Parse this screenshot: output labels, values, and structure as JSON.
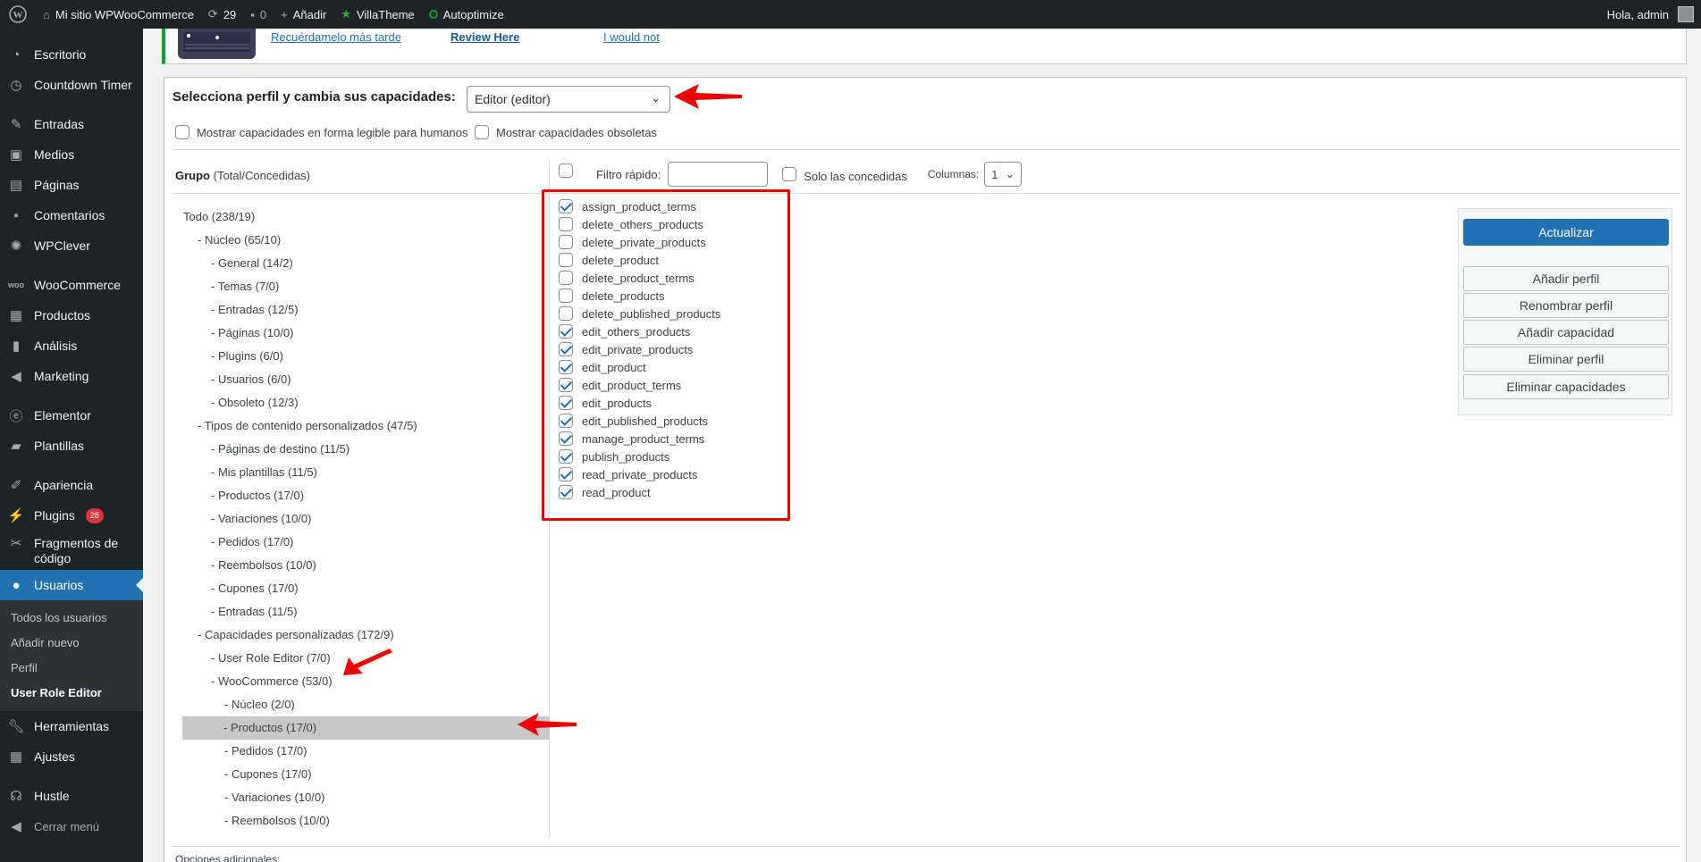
{
  "adminbar": {
    "site_name": "Mi sitio WPWooCommerce",
    "updates": "29",
    "comments": "0",
    "add_new": "Añadir",
    "villatheme": "VillaTheme",
    "autoptimize": "Autoptimize",
    "greeting": "Hola, admin"
  },
  "sidebar": {
    "items": [
      {
        "label": "Escritorio",
        "icon": "dashboard-icon"
      },
      {
        "label": "Countdown Timer",
        "icon": "clock-icon"
      },
      {
        "label": "Entradas",
        "icon": "pin-icon"
      },
      {
        "label": "Medios",
        "icon": "media-icon"
      },
      {
        "label": "Páginas",
        "icon": "page-icon"
      },
      {
        "label": "Comentarios",
        "icon": "comment-icon"
      },
      {
        "label": "WPClever",
        "icon": "bulb-icon"
      },
      {
        "label": "WooCommerce",
        "icon": "woo-icon"
      },
      {
        "label": "Productos",
        "icon": "archive-icon"
      },
      {
        "label": "Análisis",
        "icon": "chart-icon"
      },
      {
        "label": "Marketing",
        "icon": "megaphone-icon"
      },
      {
        "label": "Elementor",
        "icon": "elementor-icon"
      },
      {
        "label": "Plantillas",
        "icon": "folder-icon"
      },
      {
        "label": "Apariencia",
        "icon": "brush-icon"
      },
      {
        "label": "Plugins",
        "icon": "plugin-icon",
        "badge": "28"
      },
      {
        "label": "Fragmentos de código",
        "icon": "scissors-icon"
      },
      {
        "label": "Usuarios",
        "icon": "user-icon"
      },
      {
        "label": "Herramientas",
        "icon": "wrench-icon"
      },
      {
        "label": "Ajustes",
        "icon": "settings-icon"
      },
      {
        "label": "Hustle",
        "icon": "hustle-icon"
      },
      {
        "label": "Cerrar menú",
        "icon": "collapse-icon"
      }
    ],
    "submenu": [
      "Todos los usuarios",
      "Añadir nuevo",
      "Perfil",
      "User Role Editor"
    ]
  },
  "notice": {
    "later": "Recuérdamelo más tarde",
    "review": "Review Here",
    "never": "I would not"
  },
  "editor": {
    "role_label": "Selecciona perfil y cambia sus capacidades:",
    "role_value": "Editor (editor)",
    "opt_human": "Mostrar capacidades en forma legible para humanos",
    "opt_deprecated": "Mostrar capacidades obsoletas",
    "group_head": "Grupo",
    "group_sub": "(Total/Concedidas)",
    "quick_filter": "Filtro rápido:",
    "only_granted": "Solo las concedidas",
    "columns_label": "Columnas:",
    "columns_value": "1",
    "extra_options": "Opciones adicionales:"
  },
  "tree": [
    "Todo (238/19)",
    "- Núcleo (65/10)",
    "- General (14/2)",
    "- Temas (7/0)",
    "- Entradas (12/5)",
    "- Páginas (10/0)",
    "- Plugins (6/0)",
    "- Usuarios (6/0)",
    "- Obsoleto (12/3)",
    "- Tipos de contenido personalizados (47/5)",
    "- Páginas de destino (11/5)",
    "- Mis plantillas (11/5)",
    "- Productos (17/0)",
    "- Variaciones (10/0)",
    "- Pedidos (17/0)",
    "- Reembolsos (10/0)",
    "- Cupones (17/0)",
    "- Entradas (11/5)",
    "- Capacidades personalizadas (172/9)",
    "- User Role Editor (7/0)",
    "- WooCommerce (53/0)",
    "- Núcleo (2/0)",
    "- Productos (17/0)",
    "- Pedidos (17/0)",
    "- Cupones (17/0)",
    "- Variaciones (10/0)",
    "- Reembolsos (10/0)"
  ],
  "caps": [
    {
      "name": "assign_product_terms",
      "checked": true
    },
    {
      "name": "delete_others_products",
      "checked": false
    },
    {
      "name": "delete_private_products",
      "checked": false
    },
    {
      "name": "delete_product",
      "checked": false
    },
    {
      "name": "delete_product_terms",
      "checked": false
    },
    {
      "name": "delete_products",
      "checked": false
    },
    {
      "name": "delete_published_products",
      "checked": false
    },
    {
      "name": "edit_others_products",
      "checked": true
    },
    {
      "name": "edit_private_products",
      "checked": true
    },
    {
      "name": "edit_product",
      "checked": true
    },
    {
      "name": "edit_product_terms",
      "checked": true
    },
    {
      "name": "edit_products",
      "checked": true
    },
    {
      "name": "edit_published_products",
      "checked": true
    },
    {
      "name": "manage_product_terms",
      "checked": true
    },
    {
      "name": "publish_products",
      "checked": true
    },
    {
      "name": "read_private_products",
      "checked": true
    },
    {
      "name": "read_product",
      "checked": true
    }
  ],
  "actions": {
    "update": "Actualizar",
    "add_role": "Añadir perfil",
    "rename_role": "Renombrar perfil",
    "add_cap": "Añadir capacidad",
    "delete_role": "Eliminar perfil",
    "delete_caps": "Eliminar capacidades"
  },
  "colors": {
    "accent": "#2271b1",
    "highlight": "#ee0000",
    "notice_border": "#00a32a"
  }
}
